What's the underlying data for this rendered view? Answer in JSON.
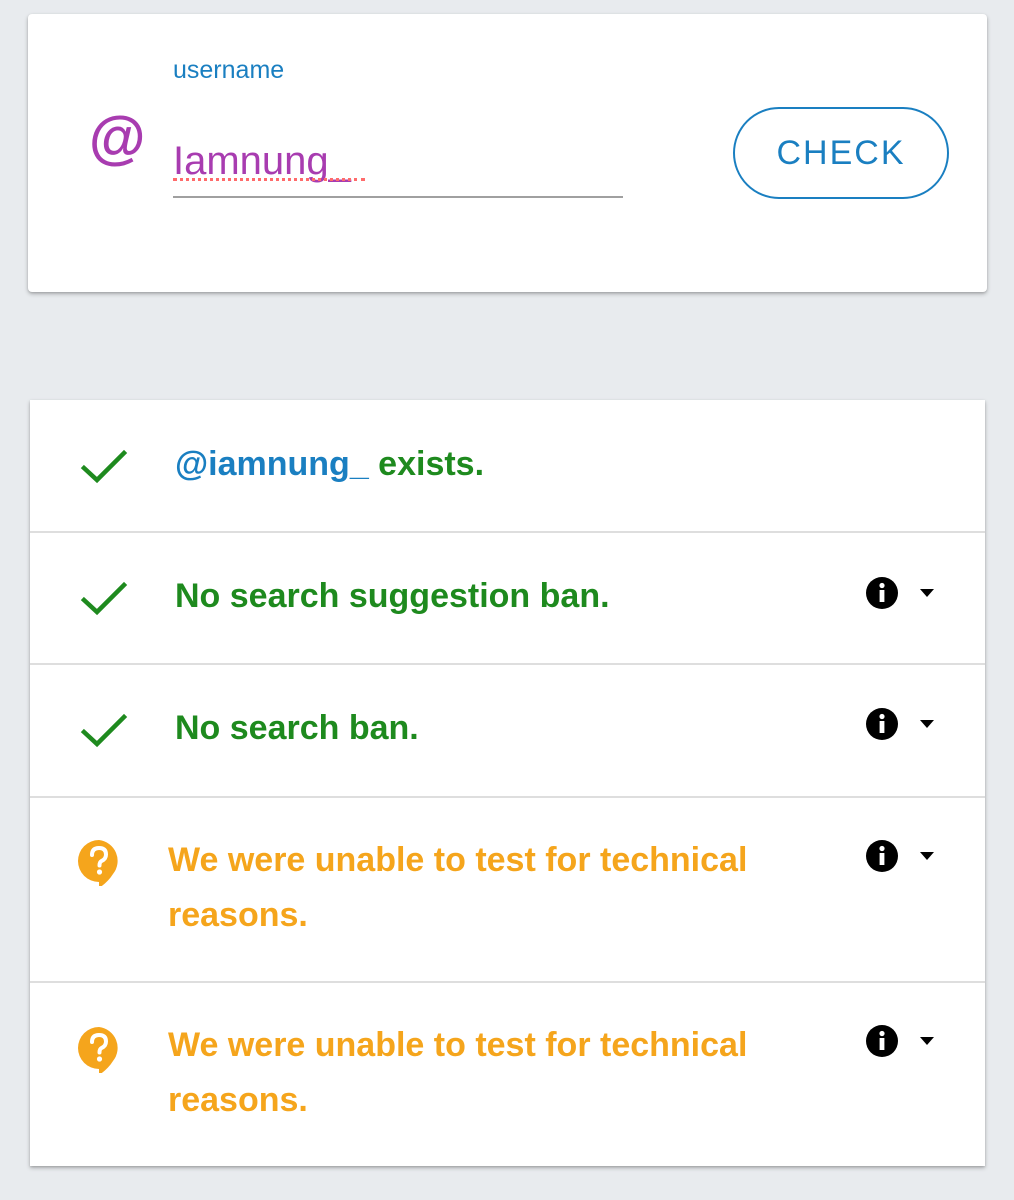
{
  "search": {
    "at_symbol": "@",
    "label": "username",
    "value": "Iamnung_",
    "button_label": "CHECK"
  },
  "results": [
    {
      "status": "ok",
      "icon": "check-icon",
      "handle": "@iamnung_",
      "text": " exists.",
      "has_info": false
    },
    {
      "status": "ok",
      "icon": "check-icon",
      "text": "No search suggestion ban.",
      "has_info": true
    },
    {
      "status": "ok",
      "icon": "check-icon",
      "text": "No search ban.",
      "has_info": true
    },
    {
      "status": "unknown",
      "icon": "question-bubble-icon",
      "text": "We were unable to test for technical reasons.",
      "has_info": true
    },
    {
      "status": "unknown",
      "icon": "question-bubble-icon",
      "text": "We were unable to test for technical reasons.",
      "has_info": true
    }
  ],
  "colors": {
    "accent": "#1a7fc1",
    "username": "#a83cb0",
    "ok": "#1e8a1e",
    "warning": "#f5a51c",
    "background": "#e8ebee"
  }
}
